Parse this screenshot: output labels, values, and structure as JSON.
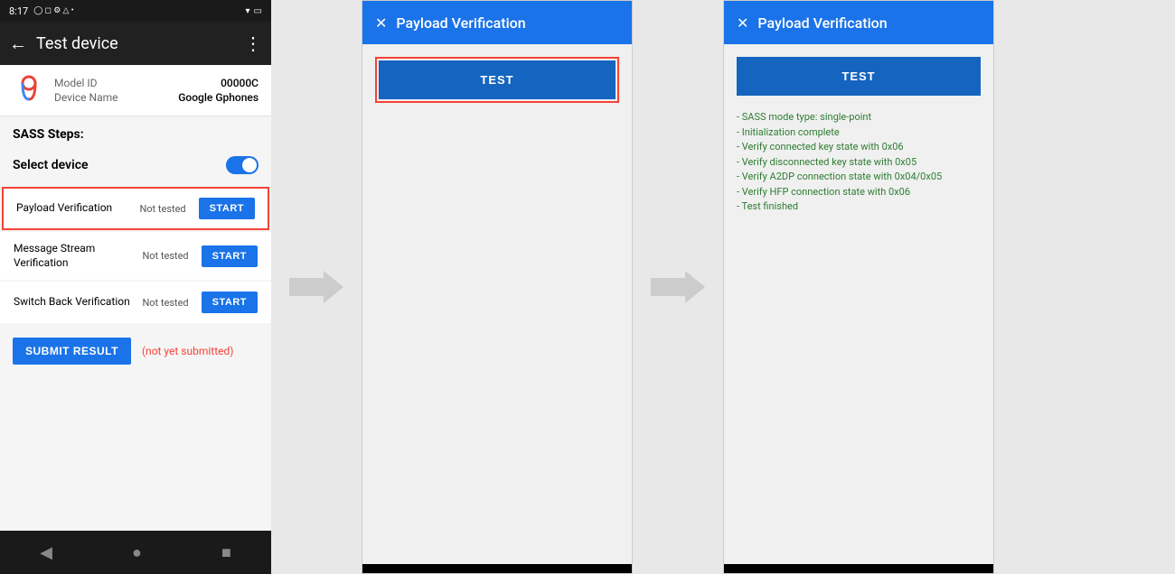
{
  "statusBar": {
    "time": "8:17",
    "rightIcons": "▾ ▾ ▴"
  },
  "appBar": {
    "title": "Test device",
    "backIcon": "←",
    "moreIcon": "⋮"
  },
  "deviceInfo": {
    "modelIdLabel": "Model ID",
    "modelIdValue": "00000C",
    "deviceNameLabel": "Device Name",
    "deviceNameValue": "Google Gphones"
  },
  "stepsSection": {
    "header": "SASS Steps:",
    "selectDeviceLabel": "Select device"
  },
  "steps": [
    {
      "name": "Payload Verification",
      "status": "Not tested",
      "btnLabel": "START",
      "highlighted": true
    },
    {
      "name": "Message Stream Verification",
      "status": "Not tested",
      "btnLabel": "START",
      "highlighted": false
    },
    {
      "name": "Switch Back Verification",
      "status": "Not tested",
      "btnLabel": "START",
      "highlighted": false
    }
  ],
  "submitBtn": "SUBMIT RESULT",
  "submitStatus": "(not yet submitted)",
  "navBar": {
    "backIcon": "◀",
    "homeIcon": "●",
    "recentIcon": "■"
  },
  "dialog1": {
    "title": "Payload Verification",
    "closeIcon": "✕",
    "testBtnLabel": "TEST"
  },
  "dialog2": {
    "title": "Payload Verification",
    "closeIcon": "✕",
    "testBtnLabel": "TEST",
    "results": [
      "- SASS mode type: single-point",
      "- Initialization complete",
      "- Verify connected key state with 0x06",
      "- Verify disconnected key state with 0x05",
      "- Verify A2DP connection state with 0x04/0x05",
      "- Verify HFP connection state with 0x06",
      "- Test finished"
    ]
  }
}
